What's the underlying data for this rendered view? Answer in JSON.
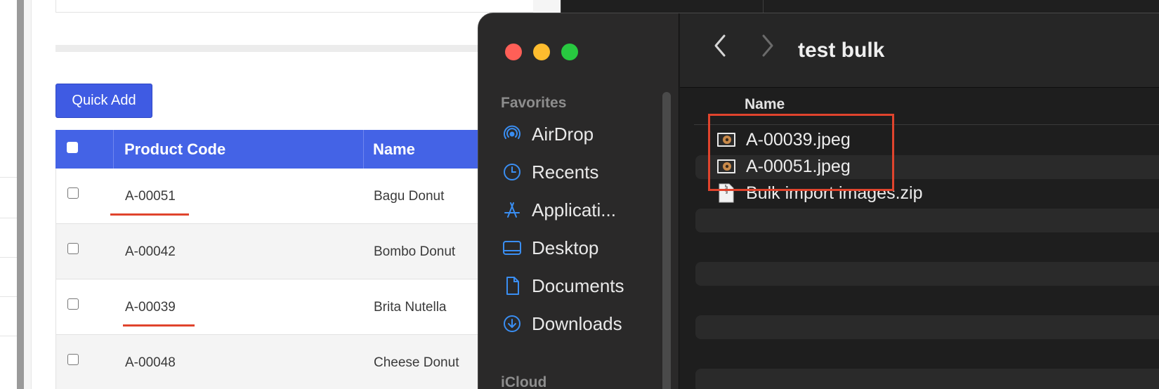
{
  "app": {
    "quick_add_label": "Quick Add",
    "columns": [
      "Product Code",
      "Name"
    ],
    "rows": [
      {
        "code": "A-00051",
        "name": "Bagu Donut",
        "underlined": true
      },
      {
        "code": "A-00042",
        "name": "Bombo Donut",
        "underlined": false
      },
      {
        "code": "A-00039",
        "name": "Brita Nutella",
        "underlined": true
      },
      {
        "code": "A-00048",
        "name": "Cheese Donut",
        "underlined": false
      }
    ]
  },
  "finder": {
    "title": "test bulk",
    "sidebar": {
      "favorites_label": "Favorites",
      "items": [
        {
          "label": "AirDrop",
          "icon": "airdrop-icon"
        },
        {
          "label": "Recents",
          "icon": "clock-icon"
        },
        {
          "label": "Applicati...",
          "icon": "applications-icon"
        },
        {
          "label": "Desktop",
          "icon": "desktop-icon"
        },
        {
          "label": "Documents",
          "icon": "document-icon"
        },
        {
          "label": "Downloads",
          "icon": "download-icon"
        }
      ],
      "icloud_label": "iCloud"
    },
    "column_name": "Name",
    "files": [
      {
        "name": "A-00039.jpeg",
        "icon": "image-file-icon",
        "highlighted": true
      },
      {
        "name": "A-00051.jpeg",
        "icon": "image-file-icon",
        "highlighted": true
      },
      {
        "name": "Bulk import images.zip",
        "icon": "zip-file-icon",
        "highlighted": false
      }
    ]
  },
  "colors": {
    "accent_blue": "#4463e6",
    "annotation_red": "#e0442d",
    "finder_dark": "#1e1e1e",
    "sidebar_icon_blue": "#3a8ef2"
  }
}
